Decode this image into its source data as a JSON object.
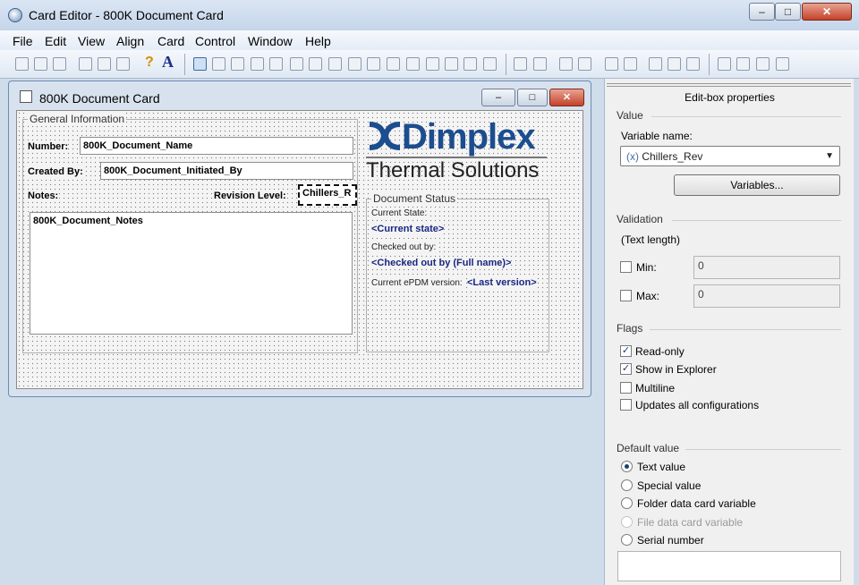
{
  "window": {
    "title": "Card Editor - 800K Document Card"
  },
  "menu": [
    "File",
    "Edit",
    "View",
    "Align",
    "Card",
    "Control",
    "Window",
    "Help"
  ],
  "child": {
    "title": "800K Document Card"
  },
  "card": {
    "general_group": "General Information",
    "number_label": "Number:",
    "number_value": "800K_Document_Name",
    "created_label": "Created By:",
    "created_value": "800K_Document_Initiated_By",
    "notes_label": "Notes:",
    "revision_label": "Revision Level:",
    "revision_value": "Chillers_R",
    "notes_value": "800K_Document_Notes",
    "logo_name": "Dimplex",
    "logo_sub": "Thermal Solutions",
    "status_group": "Document Status",
    "current_state_label": "Current State:",
    "current_state_value": "<Current state>",
    "checked_label": "Checked out by:",
    "checked_value": "<Checked out by (Full name)>",
    "version_label": "Current ePDM version:",
    "version_value": "<Last version>"
  },
  "panel": {
    "title": "Edit-box properties",
    "value_section": "Value",
    "variable_name_label": "Variable name:",
    "variable_name_value": "Chillers_Rev",
    "variables_button": "Variables...",
    "validation_section": "Validation",
    "text_length_label": "(Text length)",
    "min_label": "Min:",
    "min_value": "0",
    "max_label": "Max:",
    "max_value": "0",
    "flags_section": "Flags",
    "flags": [
      {
        "label": "Read-only",
        "checked": true
      },
      {
        "label": "Show in Explorer",
        "checked": true
      },
      {
        "label": "Multiline",
        "checked": false
      },
      {
        "label": "Updates all configurations",
        "checked": false
      }
    ],
    "default_section": "Default value",
    "defaults": [
      {
        "label": "Text value",
        "selected": true
      },
      {
        "label": "Special value",
        "selected": false
      },
      {
        "label": "Folder data card variable",
        "selected": false
      },
      {
        "label": "File data card variable",
        "selected": false,
        "disabled": true
      },
      {
        "label": "Serial number",
        "selected": false
      }
    ]
  },
  "colors": {
    "accent": "#1c4d8e",
    "status_text": "#1a2680"
  }
}
